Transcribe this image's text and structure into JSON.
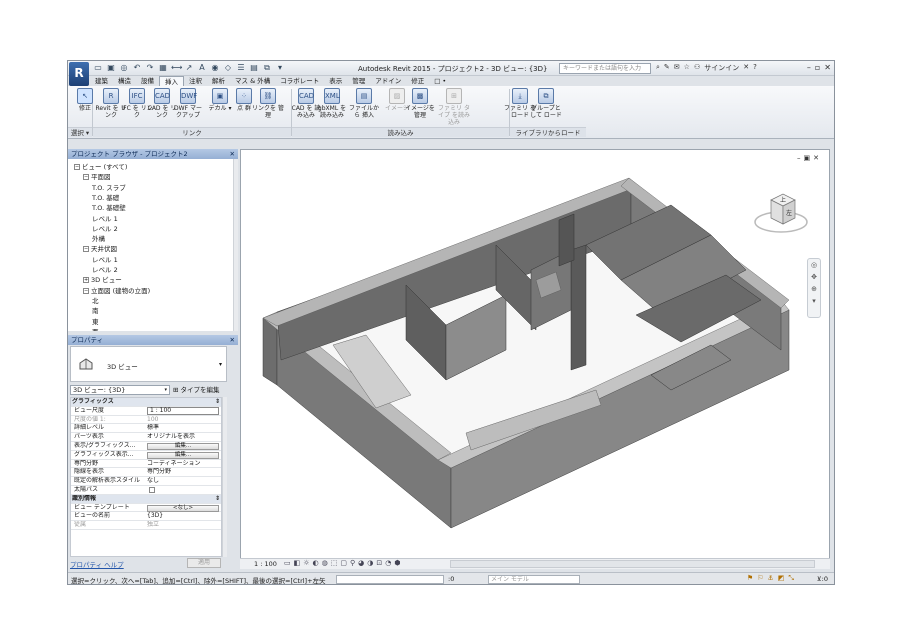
{
  "window": {
    "app_icon": "R",
    "title": "Autodesk Revit 2015 -   プロジェクト2 - 3D ビュー: {3D}",
    "search_placeholder": "キーワードまたは語句を入力",
    "signin": "サインイン",
    "help": "?"
  },
  "tabs": [
    "建築",
    "構造",
    "設備",
    "挿入",
    "注釈",
    "解析",
    "マス & 外構",
    "コラボレート",
    "表示",
    "管理",
    "アドイン",
    "修正",
    "□ •"
  ],
  "active_tab": "挿入",
  "ribbon": {
    "buttons": [
      {
        "label": "修正",
        "icon": "cursor-icon",
        "glyph": "↖"
      },
      {
        "label": "Revit を リンク",
        "icon": "revit-link-icon",
        "glyph": "R"
      },
      {
        "label": "IFC を リンク",
        "icon": "ifc-link-icon",
        "glyph": "IFC"
      },
      {
        "label": "CAD を リンク",
        "icon": "cad-link-icon",
        "glyph": "CAD"
      },
      {
        "label": "DWF マークアップ",
        "icon": "dwf-icon",
        "glyph": "DWF"
      },
      {
        "label": "デカル ▾",
        "icon": "decal-icon",
        "glyph": "▣"
      },
      {
        "label": "点 群",
        "icon": "point-cloud-icon",
        "glyph": "⁘"
      },
      {
        "label": "リンクを 管理",
        "icon": "manage-links-icon",
        "glyph": "⛓"
      },
      {
        "label": "CAD を 読み込み",
        "icon": "cad-import-icon",
        "glyph": "CAD"
      },
      {
        "label": "gbXML を 読み込み",
        "icon": "gbxml-icon",
        "glyph": "XML"
      },
      {
        "label": "ファイルから 挿入",
        "icon": "insert-file-icon",
        "glyph": "▤"
      },
      {
        "label": "イメージ",
        "icon": "image-icon",
        "glyph": "▨"
      },
      {
        "label": "イメージを 管理",
        "icon": "manage-images-icon",
        "glyph": "▩"
      },
      {
        "label": "ファミリ タイプ を読み込み",
        "icon": "family-type-icon",
        "glyph": "⊞"
      },
      {
        "label": "ファミリ をロード",
        "icon": "load-family-icon",
        "glyph": "⤓"
      },
      {
        "label": "グループとして ロード",
        "icon": "load-group-icon",
        "glyph": "⧉"
      }
    ],
    "panels": [
      "選択 ▾",
      "リンク",
      "読み込み",
      "ライブラリからロード"
    ]
  },
  "project_browser": {
    "title": "プロジェクト ブラウザ - プロジェクト2",
    "items": [
      {
        "label": "ビュー (すべて)",
        "level": 0,
        "toggle": "−"
      },
      {
        "label": "平面図",
        "level": 1,
        "toggle": "−"
      },
      {
        "label": "T.O. スラブ",
        "level": 2,
        "toggle": ""
      },
      {
        "label": "T.O. 基礎",
        "level": 2,
        "toggle": ""
      },
      {
        "label": "T.O. 基礎壁",
        "level": 2,
        "toggle": ""
      },
      {
        "label": "レベル 1",
        "level": 2,
        "toggle": ""
      },
      {
        "label": "レベル 2",
        "level": 2,
        "toggle": ""
      },
      {
        "label": "外構",
        "level": 2,
        "toggle": ""
      },
      {
        "label": "天井伏図",
        "level": 1,
        "toggle": "−"
      },
      {
        "label": "レベル 1",
        "level": 2,
        "toggle": ""
      },
      {
        "label": "レベル 2",
        "level": 2,
        "toggle": ""
      },
      {
        "label": "3D ビュー",
        "level": 1,
        "toggle": "+"
      },
      {
        "label": "立面図 (建物の立面)",
        "level": 1,
        "toggle": "−"
      },
      {
        "label": "北",
        "level": 2,
        "toggle": ""
      },
      {
        "label": "南",
        "level": 2,
        "toggle": ""
      },
      {
        "label": "東",
        "level": 2,
        "toggle": ""
      },
      {
        "label": "西",
        "level": 2,
        "toggle": ""
      }
    ]
  },
  "properties": {
    "title": "プロパティ",
    "type_name": "3D ビュー",
    "view_selector": "3D ビュー: {3D}",
    "edit_type": "タイプを編集",
    "rows": [
      {
        "kind": "group",
        "key": "グラフィックス",
        "value": "⇕"
      },
      {
        "kind": "input",
        "key": "ビュー尺度",
        "value": "1 : 100"
      },
      {
        "kind": "dim",
        "key": "尺度の値   1:",
        "value": "100"
      },
      {
        "kind": "text",
        "key": "詳細レベル",
        "value": "標準"
      },
      {
        "kind": "text",
        "key": "パーツ表示",
        "value": "オリジナルを表示"
      },
      {
        "kind": "button",
        "key": "表示/グラフィックス...",
        "value": "編集..."
      },
      {
        "kind": "button",
        "key": "グラフィックス表示...",
        "value": "編集..."
      },
      {
        "kind": "text",
        "key": "専門分野",
        "value": "コーディネーション"
      },
      {
        "kind": "text",
        "key": "隠線を表示",
        "value": "専門分野"
      },
      {
        "kind": "text",
        "key": "既定の解析表示スタイル",
        "value": "なし"
      },
      {
        "kind": "check",
        "key": "太陽パス",
        "value": ""
      },
      {
        "kind": "group",
        "key": "識別情報",
        "value": "⇕"
      },
      {
        "kind": "button",
        "key": "ビュー テンプレート",
        "value": "<なし>"
      },
      {
        "kind": "text",
        "key": "ビューの名前",
        "value": "{3D}"
      },
      {
        "kind": "dim",
        "key": "従属",
        "value": "独立"
      }
    ],
    "help": "プロパティ ヘルプ",
    "apply": "適用"
  },
  "viewport": {
    "scale": "1 : 100",
    "viewcube_face": "上",
    "viewcube_side": "左"
  },
  "statusbar": {
    "text": "選択=クリック、次へ=[Tab]、追加=[Ctrl]、除外=[SHIFT]、最後の選択=[Ctrl]+左矢",
    "sel_value": ":0",
    "model": "メイン モデル",
    "filter_count": ":0"
  }
}
